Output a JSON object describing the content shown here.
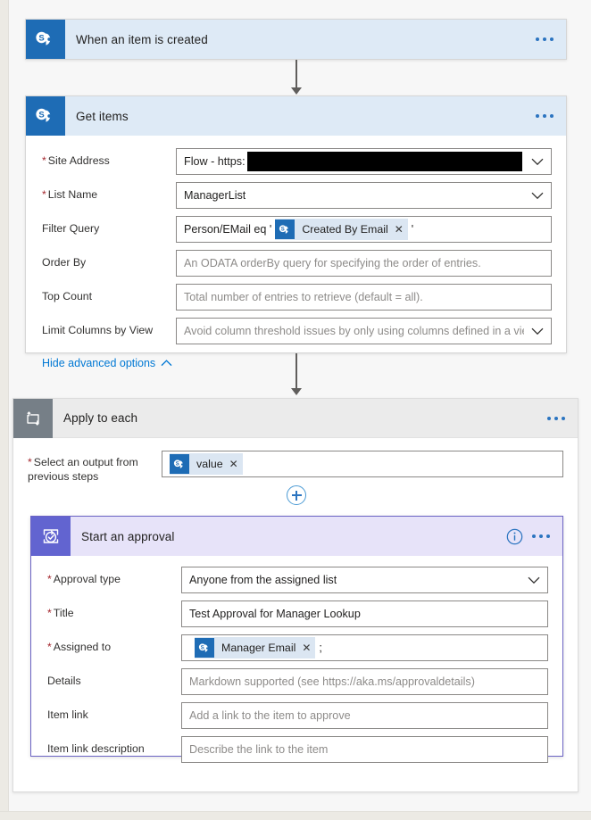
{
  "flow": {
    "trigger": {
      "title": "When an item is created",
      "icon": "sharepoint-icon",
      "header_color": "#deeaf6",
      "icon_bg": "#1e6cb5",
      "menu": "..."
    },
    "get_items": {
      "title": "Get items",
      "icon": "sharepoint-icon",
      "header_color": "#deeaf6",
      "icon_bg": "#1e6cb5",
      "menu": "...",
      "fields": [
        {
          "label": "Site Address",
          "required": true,
          "type": "dropdown",
          "value": "Flow - https:",
          "redacted": true
        },
        {
          "label": "List Name",
          "required": true,
          "type": "dropdown",
          "value": "ManagerList"
        },
        {
          "label": "Filter Query",
          "required": false,
          "type": "token-text",
          "prefix": "Person/EMail eq '",
          "token": "Created By Email",
          "token_icon": "sharepoint-icon",
          "suffix": "'"
        },
        {
          "label": "Order By",
          "required": false,
          "type": "text",
          "placeholder": "An ODATA orderBy query for specifying the order of entries."
        },
        {
          "label": "Top Count",
          "required": false,
          "type": "text",
          "placeholder": "Total number of entries to retrieve (default = all)."
        },
        {
          "label": "Limit Columns by View",
          "required": false,
          "type": "dropdown",
          "placeholder": "Avoid column threshold issues by only using columns defined in a view"
        }
      ],
      "advanced_link": "Hide advanced options"
    },
    "apply_to_each": {
      "title": "Apply to each",
      "icon": "loop-icon",
      "header_color": "#ebebeb",
      "icon_bg": "#767f87",
      "menu": "...",
      "field": {
        "label": "Select an output from previous steps",
        "required": true,
        "token": "value",
        "token_icon": "sharepoint-icon"
      },
      "add_button": "add-step-button"
    },
    "approval": {
      "title": "Start an approval",
      "icon": "approval-icon",
      "header_color": "#e7e3f9",
      "icon_bg": "#6264d0",
      "border_color": "#6b63c4",
      "info_icon": "info-icon",
      "menu": "...",
      "fields": [
        {
          "label": "Approval type",
          "required": true,
          "type": "dropdown",
          "value": "Anyone from the assigned list"
        },
        {
          "label": "Title",
          "required": true,
          "type": "text",
          "value": "Test Approval for Manager Lookup"
        },
        {
          "label": "Assigned to",
          "required": true,
          "type": "token-text",
          "prefix": "",
          "token": "Manager Email",
          "token_icon": "sharepoint-icon",
          "suffix": ";"
        },
        {
          "label": "Details",
          "required": false,
          "type": "text",
          "placeholder": "Markdown supported (see https://aka.ms/approvaldetails)"
        },
        {
          "label": "Item link",
          "required": false,
          "type": "text",
          "placeholder": "Add a link to the item to approve"
        },
        {
          "label": "Item link description",
          "required": false,
          "type": "text",
          "placeholder": "Describe the link to the item"
        }
      ]
    }
  }
}
